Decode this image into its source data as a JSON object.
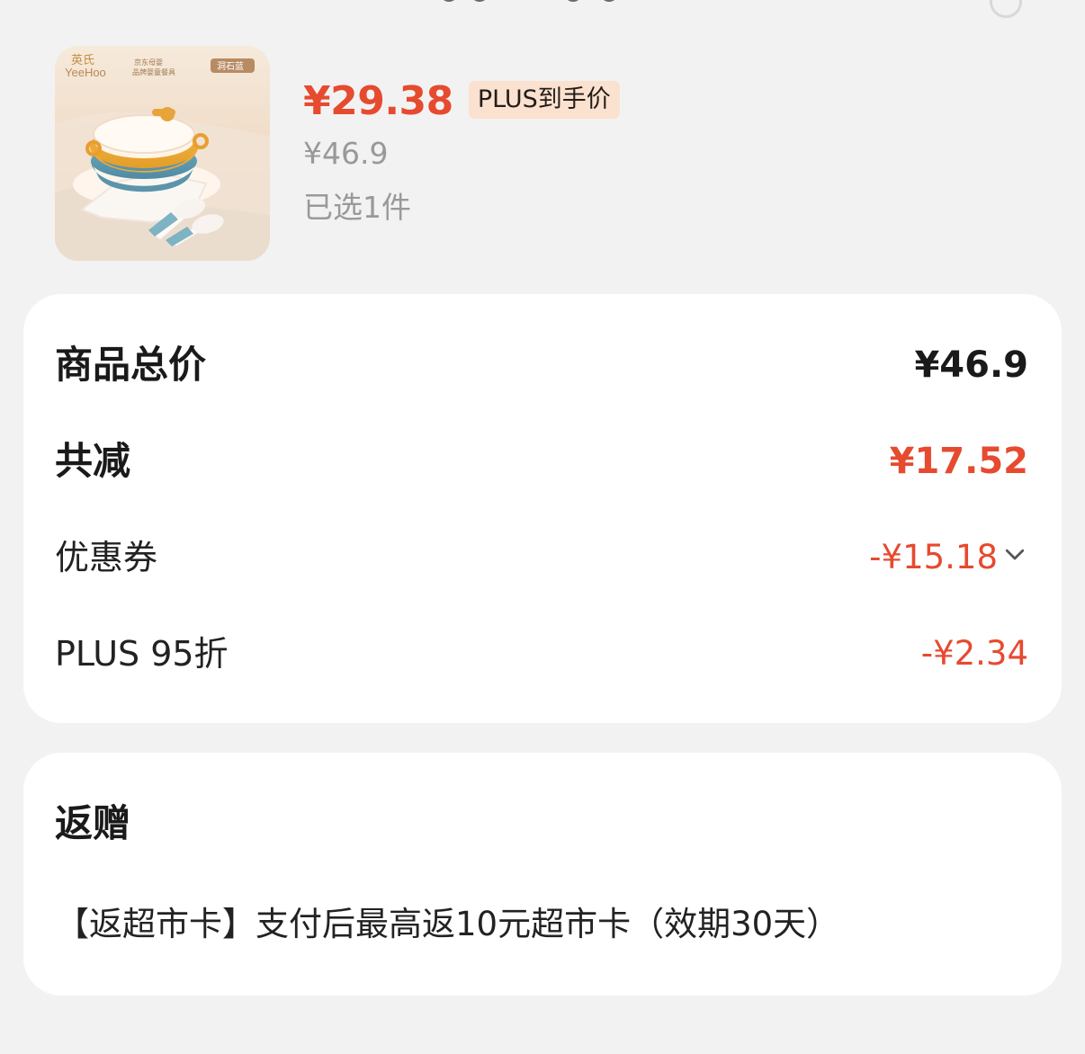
{
  "product": {
    "price_current": "¥29.38",
    "plus_tag": "PLUS到手价",
    "price_original": "¥46.9",
    "selected_count": "已选1件",
    "image": {
      "brand_mark": "英氏",
      "brand_name": "YeeHoo",
      "subtitle": "京东母婴",
      "subtitle2": "品牌婴童餐具",
      "badge": "洞石蓝"
    }
  },
  "summary": {
    "items": [
      {
        "label": "商品总价",
        "value": "¥46.9",
        "style": "bold"
      },
      {
        "label": "共减",
        "value": "¥17.52",
        "style": "bold-red"
      },
      {
        "label": "优惠券",
        "value": "-¥15.18",
        "style": "red",
        "has_chevron": true
      },
      {
        "label": "PLUS 95折",
        "value": "-¥2.34",
        "style": "red"
      }
    ]
  },
  "gift": {
    "title": "返赠",
    "text": "【返超市卡】支付后最高返10元超市卡（效期30天）"
  },
  "colors": {
    "accent": "#e64a2f",
    "background": "#f2f2f2",
    "card": "#ffffff",
    "tag_bg": "#fbe1cf",
    "muted_text": "#999999"
  }
}
